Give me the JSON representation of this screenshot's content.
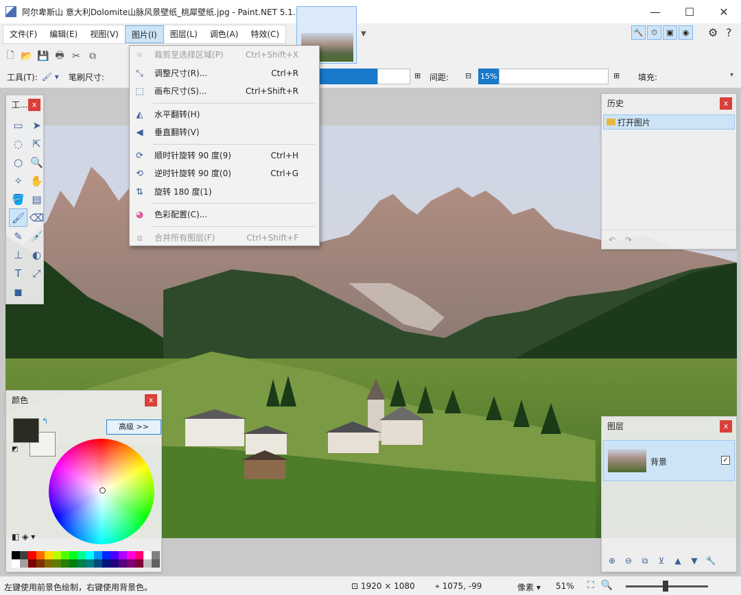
{
  "window": {
    "title": "阿尔卑斯山 意大利Dolomite山脉风景壁纸_桃犀壁纸.jpg - Paint.NET 5.1.7",
    "controls": [
      "—",
      "☐",
      "✕"
    ]
  },
  "menubar": {
    "items": [
      "文件(F)",
      "编辑(E)",
      "视图(V)",
      "图片(I)",
      "图层(L)",
      "调色(A)",
      "特效(C)"
    ],
    "active_index": 3
  },
  "optionsbar": {
    "tool_label": "工具(T):",
    "brush_size_label": "笔刷尺寸:",
    "spacing_label": "间距:",
    "spacing_value": "15%",
    "fill_label": "填充:"
  },
  "image_menu": {
    "items": [
      {
        "label": "裁剪至选择区域(P)",
        "shortcut": "Ctrl+Shift+X",
        "icon": "crop-icon",
        "disabled": true
      },
      {
        "label": "调整尺寸(R)...",
        "shortcut": "Ctrl+R",
        "icon": "resize-icon",
        "disabled": false
      },
      {
        "label": "画布尺寸(S)...",
        "shortcut": "Ctrl+Shift+R",
        "icon": "canvas-size-icon",
        "disabled": false
      },
      {
        "sep": true
      },
      {
        "label": "水平翻转(H)",
        "shortcut": "",
        "icon": "flip-horizontal-icon",
        "disabled": false
      },
      {
        "label": "垂直翻转(V)",
        "shortcut": "",
        "icon": "flip-vertical-icon",
        "disabled": false
      },
      {
        "sep": true
      },
      {
        "label": "顺时针旋转 90 度(9)",
        "shortcut": "Ctrl+H",
        "icon": "rotate-cw-icon",
        "disabled": false
      },
      {
        "label": "逆时针旋转 90 度(0)",
        "shortcut": "Ctrl+G",
        "icon": "rotate-ccw-icon",
        "disabled": false
      },
      {
        "label": "旋转 180 度(1)",
        "shortcut": "",
        "icon": "rotate-180-icon",
        "disabled": false
      },
      {
        "sep": true
      },
      {
        "label": "色彩配置(C)...",
        "shortcut": "",
        "icon": "color-profile-icon",
        "disabled": false
      },
      {
        "sep": true
      },
      {
        "label": "合并所有图层(F)",
        "shortcut": "Ctrl+Shift+F",
        "icon": "flatten-icon",
        "disabled": true
      }
    ]
  },
  "tools_panel": {
    "title": "工..."
  },
  "history_panel": {
    "title": "历史",
    "items": [
      "打开图片"
    ]
  },
  "layers_panel": {
    "title": "图层",
    "layers": [
      {
        "name": "背景",
        "visible": true
      }
    ]
  },
  "colors_panel": {
    "title": "颜色",
    "advanced_button": "高级 >>",
    "primary": "#2b2b24",
    "secondary": "#f2f2ee"
  },
  "statusbar": {
    "hint": "左键使用前景色绘制，右键使用背景色。",
    "image_size": "1920 × 1080",
    "cursor_pos": "1075, -99",
    "unit": "像素",
    "zoom": "51%"
  },
  "colors": {
    "accent": "#1979ca",
    "selection": "#cde4f7"
  }
}
